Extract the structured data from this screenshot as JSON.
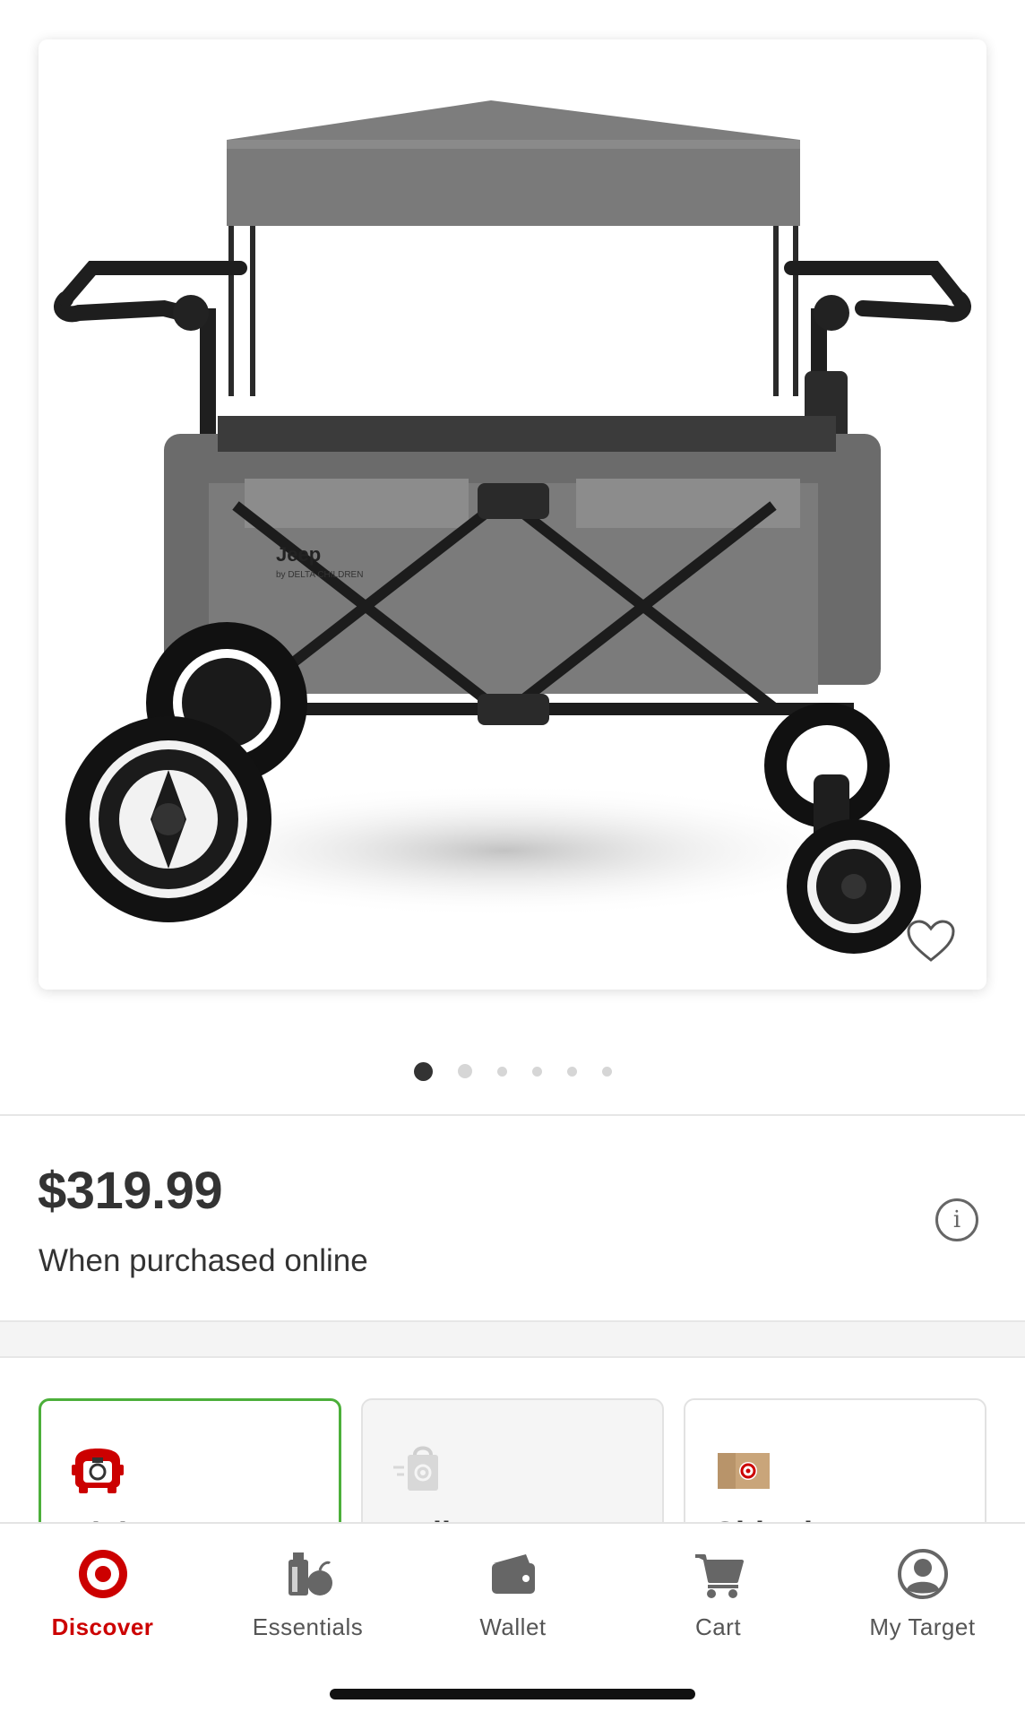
{
  "product": {
    "image_alt": "Jeep by Delta Children stroller wagon",
    "brand_mark": "Jeep",
    "brand_sub": "by DELTA CHILDREN",
    "image_count": 6,
    "current_image_index": 0
  },
  "pricing": {
    "price": "$319.99",
    "note": "When purchased online"
  },
  "fulfillment": {
    "options": [
      {
        "label": "Pick",
        "icon": "pickup-car-icon",
        "selected": true
      },
      {
        "label": "Deli",
        "icon": "delivery-bag-icon",
        "selected": false
      },
      {
        "label": "Shipping",
        "icon": "shipping-box-icon",
        "selected": false
      }
    ]
  },
  "tabbar": {
    "tabs": [
      {
        "label": "Discover",
        "icon": "target-bullseye-icon",
        "active": true
      },
      {
        "label": "Essentials",
        "icon": "essentials-icon",
        "active": false
      },
      {
        "label": "Wallet",
        "icon": "wallet-icon",
        "active": false
      },
      {
        "label": "Cart",
        "icon": "cart-icon",
        "active": false
      },
      {
        "label": "My Target",
        "icon": "account-icon",
        "active": false
      }
    ]
  },
  "colors": {
    "brand_red": "#cc0000",
    "selected_green": "#4caf3a",
    "text_dark": "#333333"
  }
}
